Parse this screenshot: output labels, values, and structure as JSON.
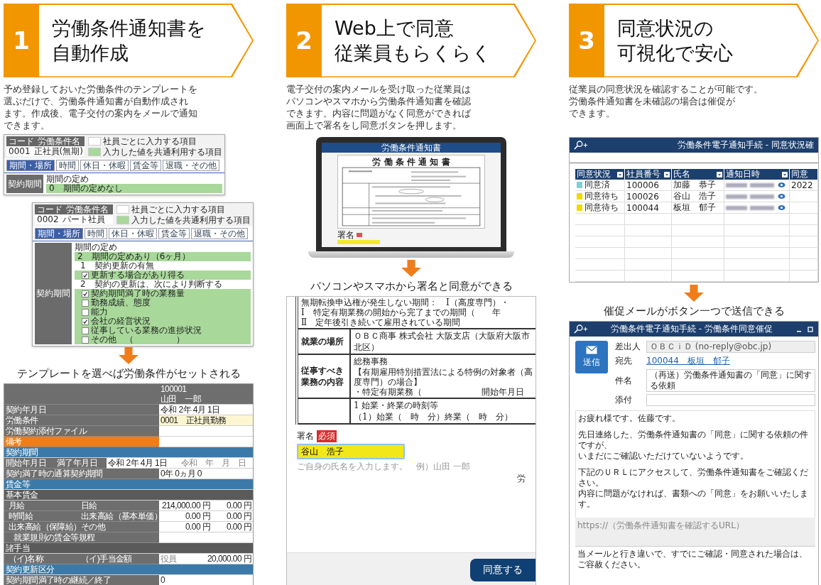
{
  "steps": [
    {
      "number": "1",
      "title": [
        "労働条件通知書を",
        "自動作成"
      ],
      "description": [
        "予め登録しておいた労働条件のテンプレートを",
        "選ぶだけで、労働条件通知書が自動作成され",
        "ます。作成後、電子交付の案内をメールで通知",
        "できます。"
      ]
    },
    {
      "number": "2",
      "title": [
        "Web上で同意",
        "従業員もらくらく"
      ],
      "description": [
        "電子交付の案内メールを受け取った従業員は",
        "パソコンやスマホから労働条件通知書を確認",
        "できます。内容に問題がなく同意ができれば",
        "画面上で署名をし同意ボタンを押します。"
      ]
    },
    {
      "number": "3",
      "title": [
        "同意状況の",
        "可視化で安心"
      ],
      "description": [
        "従業員の同意状況を確認することが可能です。",
        "労働条件通知書を未確認の場合は催促が",
        "できます。"
      ]
    }
  ],
  "template_forms": [
    {
      "code_label": "コード",
      "name_label": "労働条件名",
      "code": "0001",
      "name": "正社員(無期)",
      "legend": [
        "社員ごとに入力する項目",
        "入力した値を共通利用する項目"
      ],
      "tabs": [
        {
          "label": "期間・場所",
          "selected": true
        },
        {
          "label": "時間",
          "selected": false
        },
        {
          "label": "休日・休暇",
          "selected": false
        },
        {
          "label": "賃金等",
          "selected": false
        },
        {
          "label": "退職・その他",
          "selected": false
        }
      ],
      "side_label": "契約期間",
      "lines": [
        {
          "kind": "heading",
          "text": "期間の定め"
        },
        {
          "kind": "choice",
          "text": "0　期間の定めなし",
          "highlighted": true
        }
      ]
    },
    {
      "code_label": "コード",
      "name_label": "労働条件名",
      "code": "0002",
      "name": "パート社員",
      "legend": [
        "社員ごとに入力する項目",
        "入力した値を共通利用する項目"
      ],
      "tabs": [
        {
          "label": "期間・場所",
          "selected": true
        },
        {
          "label": "時間",
          "selected": false
        },
        {
          "label": "休日・休暇",
          "selected": false
        },
        {
          "label": "賃金等",
          "selected": false
        },
        {
          "label": "退職・その他",
          "selected": false
        }
      ],
      "side_label": "契約期間",
      "lines": [
        {
          "kind": "heading",
          "text": "期間の定め"
        },
        {
          "kind": "choice",
          "text": "2　期間の定めあり（6ヶ月）",
          "highlighted": true
        },
        {
          "kind": "sub",
          "text": "1　契約更新の有無"
        },
        {
          "kind": "check",
          "text": "更新する場合があり得る",
          "checked": true,
          "highlighted": true
        },
        {
          "kind": "sub",
          "text": "2　契約の更新は、次により判断する"
        },
        {
          "kind": "check",
          "text": "契約期間満了時の業務量",
          "checked": true,
          "highlighted": true
        },
        {
          "kind": "check",
          "text": "勤務成績、態度",
          "checked": false,
          "highlighted": true
        },
        {
          "kind": "check",
          "text": "能力",
          "checked": false,
          "highlighted": true
        },
        {
          "kind": "check",
          "text": "会社の経営状況",
          "checked": true,
          "highlighted": true
        },
        {
          "kind": "check",
          "text": "従事している業務の進捗状況",
          "checked": false,
          "highlighted": true
        },
        {
          "kind": "check",
          "text": "その他　（　　　　　）",
          "checked": false,
          "highlighted": true
        }
      ]
    }
  ],
  "caption_1": "テンプレートを選べば労働条件がセットされる",
  "employee_table": [
    {
      "kind": "head",
      "cells": [
        "100001",
        "山田　一郎"
      ]
    },
    {
      "kind": "pair",
      "cells": [
        "契約年月日",
        "令和 2年 4月 1日"
      ]
    },
    {
      "kind": "choice",
      "cells": [
        "労働条件",
        "0001　正社員勤務"
      ]
    },
    {
      "kind": "pair",
      "cells": [
        "労働契約添付ファイル"
      ]
    },
    {
      "kind": "accent",
      "cells": [
        "備考"
      ]
    },
    {
      "kind": "section",
      "cells": [
        "契約期間"
      ]
    },
    {
      "kind": "dates",
      "cells": [
        "開始年月日",
        "満了年月日",
        "令和 2年 4月 1日",
        "令和　年　月　日"
      ]
    },
    {
      "kind": "pair",
      "cells": [
        "契約満了時の通算契約期間",
        "0年 0ヵ月 0"
      ]
    },
    {
      "kind": "section",
      "cells": [
        "賃金等"
      ]
    },
    {
      "kind": "group",
      "cells": [
        "基本賃金"
      ]
    },
    {
      "kind": "money",
      "cells": [
        "月給",
        "日給",
        "214,000.00",
        "円",
        "0.00",
        "円"
      ]
    },
    {
      "kind": "money",
      "cells": [
        "時間給",
        "出来高給（基本単価）",
        "0.00",
        "円",
        "0.00",
        "円"
      ]
    },
    {
      "kind": "money",
      "cells": [
        "出来高給（保障給）",
        "その他",
        "0.00",
        "円",
        "0.00",
        "円"
      ]
    },
    {
      "kind": "pair",
      "cells": [
        "　就業規則の賃金等規程"
      ]
    },
    {
      "kind": "group",
      "cells": [
        "諸手当"
      ]
    },
    {
      "kind": "allowance",
      "cells": [
        "（イ)名称",
        "（イ)手当金額",
        "役員",
        "20,000.00",
        "円"
      ]
    },
    {
      "kind": "section",
      "cells": [
        "契約更新区分"
      ]
    },
    {
      "kind": "pair",
      "cells": [
        "契約期間満了時の継続／終了",
        "0"
      ]
    }
  ],
  "laptop": {
    "title": "労働条件通知書",
    "document_title": "労 働 条 件 通 知 書",
    "sign_label": "署名"
  },
  "caption_2": "パソコンやスマホから署名と同意ができる",
  "document": {
    "notes": [
      "無期転換申込権が発生しない期間：　Ⅰ（高度専門）・",
      "Ⅰ　特定有期業務の開始から完了までの期間（　　年",
      "Ⅱ　定年後引き続いて雇用されている期間"
    ],
    "rows": [
      {
        "label": "就業の場所",
        "lines": [
          "ＯＢＣ商事 株式会社 大阪支店（大阪府大阪市北区）"
        ]
      },
      {
        "label": "従事すべき業務の内容",
        "lines": [
          "総務事務",
          "【有期雇用特別措置法による特例の対象者（高度専門）の場合】",
          "・特定有期業務（　　　　　　　開始年月日"
        ]
      },
      {
        "label": "",
        "lines": [
          "1 始業・終業の時刻等",
          "（1）始業（　時　分）終業（　時　分）"
        ]
      }
    ]
  },
  "signature": {
    "label": "署名",
    "badge": "必須",
    "value": "谷山　浩子",
    "hint": "ご自身の氏名を入力します。　例）山田 一郎",
    "cut_text": "労"
  },
  "agree_button": "同意する",
  "status_window": {
    "title": "労働条件電子通知手続 - 同意状況確",
    "columns": [
      "同意状況",
      "社員番号",
      "氏名",
      "通知日時",
      "同意"
    ],
    "rows": [
      {
        "status": "同意済",
        "color": "#7ecfd6",
        "number": "100006",
        "name": "加藤　恭子",
        "extra": "2022"
      },
      {
        "status": "同意待ち",
        "color": "#f5d800",
        "number": "100026",
        "name": "谷山　浩子"
      },
      {
        "status": "同意待ち",
        "color": "#f5d800",
        "number": "100044",
        "name": "板垣　郁子"
      }
    ]
  },
  "caption_3": "催促メールがボタン一つで送信できる",
  "mail": {
    "title": "労働条件電子通知手続 - 労働条件同意催促",
    "send": "送信",
    "fields": [
      {
        "label": "差出人",
        "value": "ＯＢＣｉＤ (no-reply@obc.jp)",
        "kind": "readonly"
      },
      {
        "label": "宛先",
        "value": "100044　板垣　郁子",
        "kind": "link"
      },
      {
        "label": "件名",
        "value": "（再送）労働条件通知書の「同意」に関する依頼",
        "kind": "input"
      },
      {
        "label": "添付",
        "kind": "input"
      }
    ],
    "body": [
      [
        "お疲れ様です。佐藤です。"
      ],
      [
        "先日連絡した、労働条件通知書の「同意」に関する依頼の件ですが、",
        "いまだにご確認いただけていないようです。"
      ],
      [
        "下記のＵＲＬにアクセスして、労働条件通知書をご確認ください。",
        "内容に問題がなければ、書類への「同意」をお願いいたします。"
      ]
    ],
    "url": "https://（労働条件通知書を確認するURL）",
    "footer": "当メールと行き違いで、すでにご確認・同意された場合は、ご容赦ください。"
  }
}
